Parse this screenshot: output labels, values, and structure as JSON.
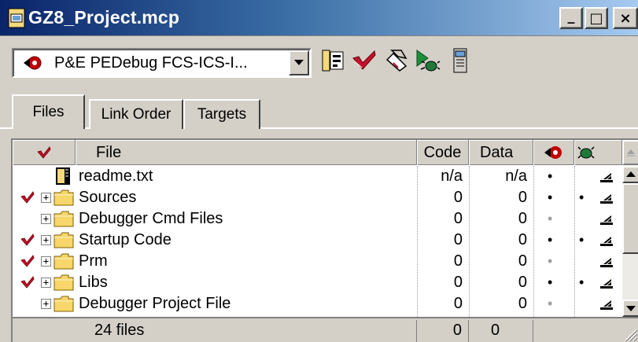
{
  "window": {
    "title": "GZ8_Project.mcp",
    "icon": "project-file-icon",
    "controls": {
      "minimize": "_",
      "maximize": "□",
      "close": "×"
    }
  },
  "toolbar": {
    "target_combo": {
      "value": "P&E PEDebug FCS-ICS-I...",
      "icon": "debug-target-icon"
    },
    "buttons": [
      {
        "name": "settings-icon"
      },
      {
        "name": "synchronize-modification-dates-icon"
      },
      {
        "name": "make-icon"
      },
      {
        "name": "debug-icon"
      },
      {
        "name": "project-inspector-icon"
      }
    ]
  },
  "tabs": [
    {
      "label": "Files",
      "active": true
    },
    {
      "label": "Link Order",
      "active": false
    },
    {
      "label": "Targets",
      "active": false
    }
  ],
  "table": {
    "headers": {
      "file": "File",
      "code": "Code",
      "data": "Data"
    },
    "rows": [
      {
        "name": "readme.txt",
        "type": "file",
        "checked": false,
        "expandable": false,
        "code": "n/a",
        "data": "n/a",
        "dot1": "black",
        "dot2": ""
      },
      {
        "name": "Sources",
        "type": "folder",
        "checked": true,
        "expandable": true,
        "code": "0",
        "data": "0",
        "dot1": "black",
        "dot2": "black"
      },
      {
        "name": "Debugger Cmd Files",
        "type": "folder",
        "checked": false,
        "expandable": true,
        "code": "0",
        "data": "0",
        "dot1": "grey",
        "dot2": ""
      },
      {
        "name": "Startup Code",
        "type": "folder",
        "checked": true,
        "expandable": true,
        "code": "0",
        "data": "0",
        "dot1": "black",
        "dot2": "black"
      },
      {
        "name": "Prm",
        "type": "folder",
        "checked": true,
        "expandable": true,
        "code": "0",
        "data": "0",
        "dot1": "grey",
        "dot2": ""
      },
      {
        "name": "Libs",
        "type": "folder",
        "checked": true,
        "expandable": true,
        "code": "0",
        "data": "0",
        "dot1": "black",
        "dot2": "black"
      },
      {
        "name": "Debugger Project File",
        "type": "folder",
        "checked": false,
        "expandable": true,
        "code": "0",
        "data": "0",
        "dot1": "grey",
        "dot2": ""
      }
    ],
    "footer": {
      "count": "24 files",
      "code_total": "0",
      "data_total": "0"
    }
  },
  "colors": {
    "title_start": "#0a246a",
    "title_end": "#a6caf0",
    "chrome": "#d4d0c8",
    "check_red": "#c8102e"
  }
}
